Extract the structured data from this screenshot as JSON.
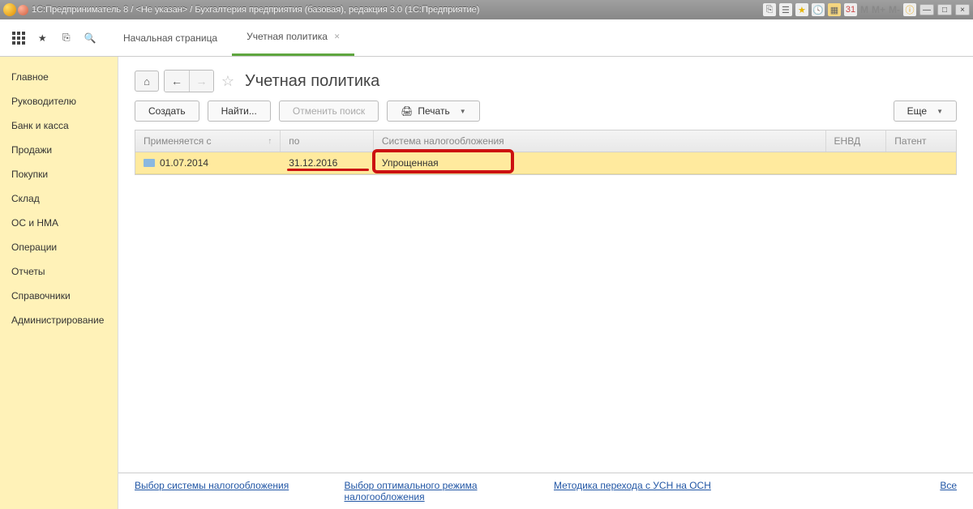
{
  "titlebar": {
    "text": "1С:Предприниматель 8 / <Не указан> / Бухгалтерия предприятия (базовая), редакция 3.0  (1С:Предприятие)"
  },
  "tabs": {
    "home": "Начальная страница",
    "active": "Учетная политика"
  },
  "sidebar": {
    "items": [
      "Главное",
      "Руководителю",
      "Банк и касса",
      "Продажи",
      "Покупки",
      "Склад",
      "ОС и НМА",
      "Операции",
      "Отчеты",
      "Справочники",
      "Администрирование"
    ]
  },
  "page": {
    "title": "Учетная политика"
  },
  "toolbar": {
    "create": "Создать",
    "find": "Найти...",
    "cancel_search": "Отменить поиск",
    "print": "Печать",
    "more": "Еще"
  },
  "table": {
    "columns": {
      "start": "Применяется с",
      "end": "по",
      "tax": "Система налогообложения",
      "envd": "ЕНВД",
      "patent": "Патент"
    },
    "rows": [
      {
        "start": "01.07.2014",
        "end": "31.12.2016",
        "tax": "Упрощенная",
        "envd": "",
        "patent": ""
      }
    ]
  },
  "footer": {
    "link1": "Выбор системы налогообложения",
    "link2": "Выбор оптимального режима налогообложения",
    "link3": "Методика перехода с УСН на ОСН",
    "all": "Все"
  },
  "mem": {
    "m": "M",
    "mplus": "M+",
    "mminus": "M-"
  }
}
